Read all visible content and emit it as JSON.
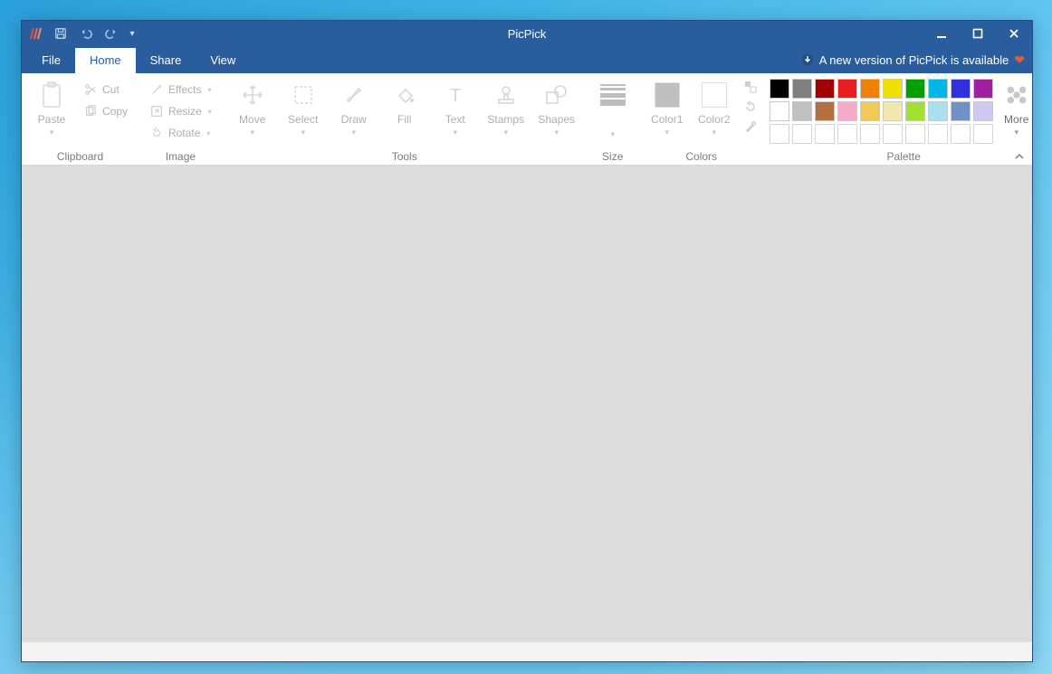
{
  "app": {
    "title": "PicPick"
  },
  "update_banner": {
    "text": "A new version of PicPick is available"
  },
  "tabs": {
    "file": "File",
    "home": "Home",
    "share": "Share",
    "view": "View",
    "active": "home"
  },
  "ribbon": {
    "groups": {
      "clipboard": {
        "label": "Clipboard",
        "paste": "Paste",
        "cut": "Cut",
        "copy": "Copy"
      },
      "image": {
        "label": "Image",
        "effects": "Effects",
        "resize": "Resize",
        "rotate": "Rotate"
      },
      "tools": {
        "label": "Tools",
        "move": "Move",
        "select": "Select",
        "draw": "Draw",
        "fill": "Fill",
        "text": "Text",
        "stamps": "Stamps",
        "shapes": "Shapes"
      },
      "size": {
        "label": "Size"
      },
      "colors": {
        "label": "Colors",
        "color1": "Color1",
        "color2": "Color2",
        "color1_value": "#8c8c8c",
        "color2_value": "#ffffff"
      },
      "palette": {
        "label": "Palette",
        "more": "More",
        "row1": [
          "#000000",
          "#808080",
          "#a30000",
          "#e81e1e",
          "#f08000",
          "#f0e000",
          "#00a000",
          "#00b8e8",
          "#3030e0",
          "#a020a0"
        ],
        "row2": [
          "#ffffff",
          "#c0c0c0",
          "#b07040",
          "#f8a8c8",
          "#f0c858",
          "#f0e8b0",
          "#a0e030",
          "#a8e0f0",
          "#7090c8",
          "#d0c8f0"
        ],
        "row3": [
          "",
          "",
          "",
          "",
          "",
          "",
          "",
          "",
          "",
          ""
        ]
      }
    }
  }
}
